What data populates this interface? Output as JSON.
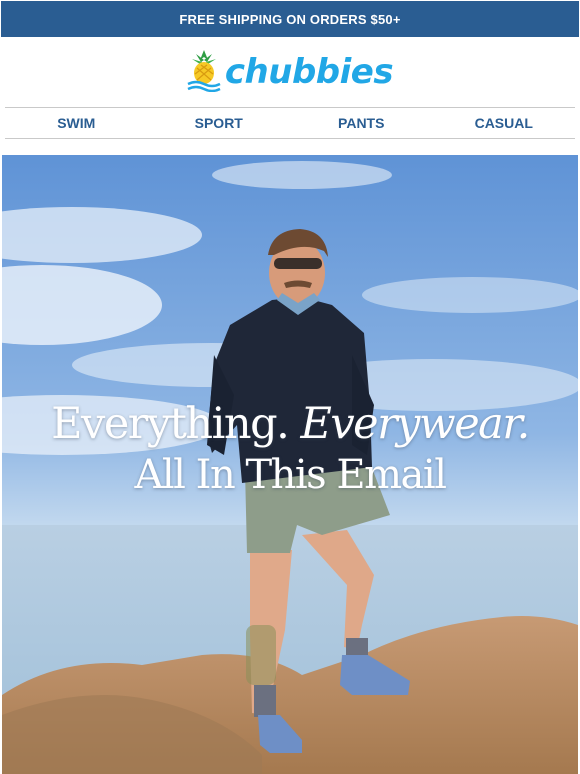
{
  "promo": {
    "text": "FREE SHIPPING ON ORDERS $50+"
  },
  "brand": {
    "name": "chubbies",
    "logo_icon": "pineapple-icon"
  },
  "nav": {
    "items": [
      {
        "label": "SWIM"
      },
      {
        "label": "SPORT"
      },
      {
        "label": "PANTS"
      },
      {
        "label": "CASUAL"
      }
    ]
  },
  "hero": {
    "headline_part1": "Everything.",
    "headline_part2": "Everywear.",
    "headline_line2": "All In This Email"
  },
  "colors": {
    "brand_blue": "#2a5d92",
    "logo_blue": "#21a7e6",
    "sky": "#6f9ed8"
  }
}
